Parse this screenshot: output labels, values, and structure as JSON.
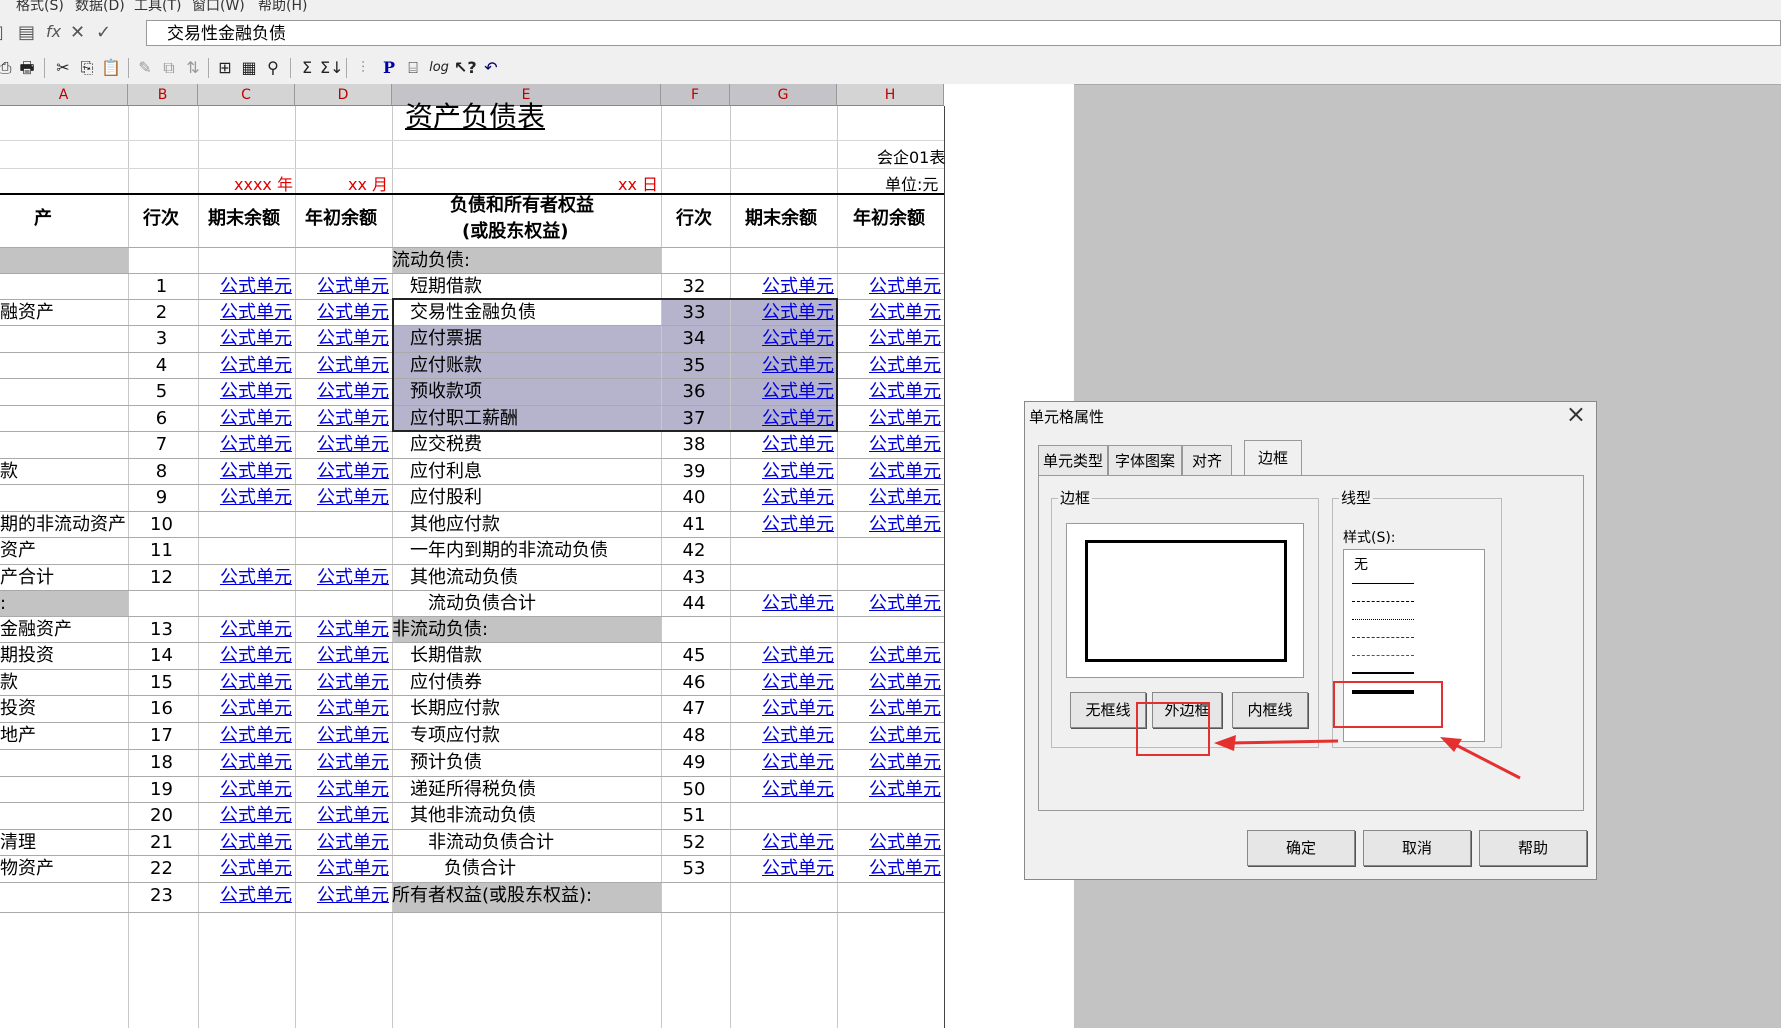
{
  "menu": [
    "格式(S)",
    "数据(D)",
    "工具(T)",
    "窗口(W)",
    "帮助(H)"
  ],
  "formula_bar": {
    "value": "交易性金融负债"
  },
  "columns": [
    "A",
    "B",
    "C",
    "D",
    "E",
    "F",
    "G",
    "H"
  ],
  "sheet": {
    "title": "资产负债表",
    "form_no": "会企01表",
    "year": "xxxx 年",
    "month": "xx 月",
    "day": "xx 日",
    "unit": "单位:元",
    "headers": {
      "asset": "产",
      "line_no": "行次",
      "end_balance": "期末余额",
      "begin_balance": "年初余额",
      "liab_line1": "负债和所有者权益",
      "liab_line2": "(或股东权益)",
      "line_no2": "行次",
      "end_balance2": "期末余额",
      "begin_balance2": "年初余额"
    },
    "formula_text": "公式单元",
    "formula_clipped": "公式",
    "rows": [
      {
        "a": "",
        "b": "",
        "c": "",
        "d": "",
        "e": "流动负债:",
        "f": "",
        "g": "",
        "h": ""
      },
      {
        "a": "",
        "b": "1",
        "c": "公式单元",
        "d": "公式单元",
        "e": "短期借款",
        "f": "32",
        "g": "公式单元",
        "h": "公式单元"
      },
      {
        "a": "融资产",
        "b": "2",
        "c": "公式单元",
        "d": "公式单元",
        "e": "交易性金融负债",
        "f": "33",
        "g": "公式单元",
        "h": "公式单元"
      },
      {
        "a": "",
        "b": "3",
        "c": "公式单元",
        "d": "公式单元",
        "e": "应付票据",
        "f": "34",
        "g": "公式单元",
        "h": "公式单元"
      },
      {
        "a": "",
        "b": "4",
        "c": "公式单元",
        "d": "公式单元",
        "e": "应付账款",
        "f": "35",
        "g": "公式单元",
        "h": "公式单元"
      },
      {
        "a": "",
        "b": "5",
        "c": "公式单元",
        "d": "公式单元",
        "e": "预收款项",
        "f": "36",
        "g": "公式单元",
        "h": "公式单元"
      },
      {
        "a": "",
        "b": "6",
        "c": "公式单元",
        "d": "公式单元",
        "e": "应付职工薪酬",
        "f": "37",
        "g": "公式单元",
        "h": "公式单元"
      },
      {
        "a": "",
        "b": "7",
        "c": "公式单元",
        "d": "公式单元",
        "e": "应交税费",
        "f": "38",
        "g": "公式单元",
        "h": "公式单元"
      },
      {
        "a": "款",
        "b": "8",
        "c": "公式单元",
        "d": "公式单元",
        "e": "应付利息",
        "f": "39",
        "g": "公式单元",
        "h": "公式单元"
      },
      {
        "a": "",
        "b": "9",
        "c": "公式单元",
        "d": "公式单元",
        "e": "应付股利",
        "f": "40",
        "g": "公式单元",
        "h": "公式单元"
      },
      {
        "a": "期的非流动资产",
        "b": "10",
        "c": "",
        "d": "",
        "e": "其他应付款",
        "f": "41",
        "g": "公式单元",
        "h": "公式单元"
      },
      {
        "a": "资产",
        "b": "11",
        "c": "",
        "d": "",
        "e": "一年内到期的非流动负债",
        "f": "42",
        "g": "",
        "h": ""
      },
      {
        "a": "产合计",
        "b": "12",
        "c": "公式单元",
        "d": "公式单元",
        "e": "其他流动负债",
        "f": "43",
        "g": "",
        "h": ""
      },
      {
        "a": ":",
        "b": "",
        "c": "",
        "d": "",
        "e": "流动负债合计",
        "f": "44",
        "g": "公式单元",
        "h": "公式单元"
      },
      {
        "a": "金融资产",
        "b": "13",
        "c": "公式单元",
        "d": "公式单元",
        "e": "非流动负债:",
        "f": "",
        "g": "",
        "h": ""
      },
      {
        "a": "期投资",
        "b": "14",
        "c": "公式单元",
        "d": "公式单元",
        "e": "长期借款",
        "f": "45",
        "g": "公式单元",
        "h": "公式单元"
      },
      {
        "a": "款",
        "b": "15",
        "c": "公式单元",
        "d": "公式单元",
        "e": "应付债券",
        "f": "46",
        "g": "公式单元",
        "h": "公式单元"
      },
      {
        "a": "投资",
        "b": "16",
        "c": "公式单元",
        "d": "公式单元",
        "e": "长期应付款",
        "f": "47",
        "g": "公式单元",
        "h": "公式单元"
      },
      {
        "a": "地产",
        "b": "17",
        "c": "公式单元",
        "d": "公式单元",
        "e": "专项应付款",
        "f": "48",
        "g": "公式单元",
        "h": "公式单元"
      },
      {
        "a": "",
        "b": "18",
        "c": "公式单元",
        "d": "公式单元",
        "e": "预计负债",
        "f": "49",
        "g": "公式单元",
        "h": "公式单元"
      },
      {
        "a": "",
        "b": "19",
        "c": "公式单元",
        "d": "公式单元",
        "e": "递延所得税负债",
        "f": "50",
        "g": "公式单元",
        "h": "公式单元"
      },
      {
        "a": "",
        "b": "20",
        "c": "公式单元",
        "d": "公式单元",
        "e": "其他非流动负债",
        "f": "51",
        "g": "",
        "h": ""
      },
      {
        "a": "清理",
        "b": "21",
        "c": "公式单元",
        "d": "公式单元",
        "e": "非流动负债合计",
        "f": "52",
        "g": "公式单元",
        "h": "公式单元"
      },
      {
        "a": "物资产",
        "b": "22",
        "c": "公式单元",
        "d": "公式单元",
        "e": "负债合计",
        "f": "53",
        "g": "公式单元",
        "h": "公式单元"
      },
      {
        "a": "",
        "b": "23",
        "c": "公式单元",
        "d": "公式单元",
        "e": "所有者权益(或股东权益):",
        "f": "",
        "g": "",
        "h": ""
      }
    ]
  },
  "dialog": {
    "title": "单元格属性",
    "tabs": [
      "单元类型",
      "字体图案",
      "对齐",
      "边框"
    ],
    "active_tab": "边框",
    "border_group": "边框",
    "line_group": "线型",
    "style_label": "样式(S):",
    "style_none": "无",
    "buttons": {
      "none": "无框线",
      "outer": "外边框",
      "inner": "内框线"
    },
    "ok": "确定",
    "cancel": "取消",
    "help": "帮助"
  },
  "colors": {
    "formula": "#0000dd",
    "red_text": "#e00000",
    "selection": "#b6b4cc",
    "annotation": "#e53030"
  }
}
